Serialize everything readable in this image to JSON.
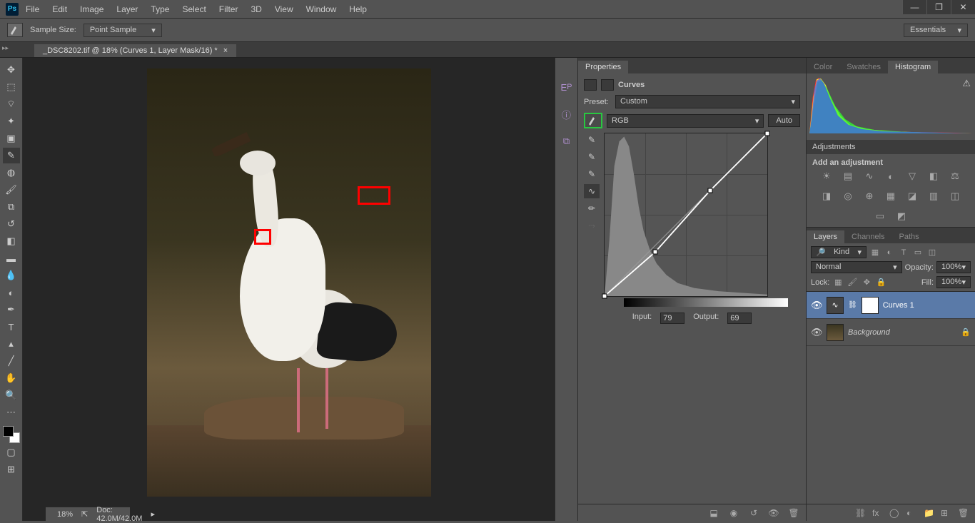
{
  "menu": [
    "File",
    "Edit",
    "Image",
    "Layer",
    "Type",
    "Select",
    "Filter",
    "3D",
    "View",
    "Window",
    "Help"
  ],
  "options": {
    "sample_label": "Sample Size:",
    "sample_value": "Point Sample",
    "workspace": "Essentials"
  },
  "document": {
    "tab_title": "_DSC8202.tif @ 18% (Curves 1, Layer Mask/16) *",
    "zoom": "18%",
    "doc_size": "Doc: 42.0M/42.0M"
  },
  "properties": {
    "tab": "Properties",
    "title": "Curves",
    "preset_label": "Preset:",
    "preset_value": "Custom",
    "channel_value": "RGB",
    "auto": "Auto",
    "input_label": "Input:",
    "input_value": "79",
    "output_label": "Output:",
    "output_value": "69"
  },
  "right_tabs": {
    "color": "Color",
    "swatches": "Swatches",
    "histogram": "Histogram",
    "adjustments": "Adjustments",
    "adj_text": "Add an adjustment",
    "layers": "Layers",
    "channels": "Channels",
    "paths": "Paths"
  },
  "layers": {
    "filter_kind": "Kind",
    "blend_mode": "Normal",
    "opacity_label": "Opacity:",
    "opacity_value": "100%",
    "lock_label": "Lock:",
    "fill_label": "Fill:",
    "fill_value": "100%",
    "items": [
      {
        "name": "Curves 1",
        "locked": false
      },
      {
        "name": "Background",
        "locked": true
      }
    ]
  }
}
